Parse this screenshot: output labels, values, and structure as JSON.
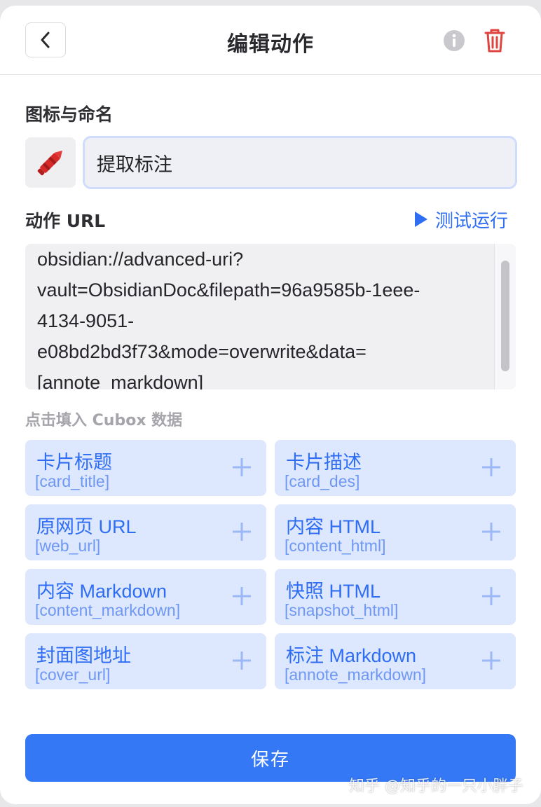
{
  "header": {
    "title": "编辑动作"
  },
  "icon_section": {
    "label": "图标与命名",
    "emoji": "🖍️",
    "name_value": "提取标注"
  },
  "url_section": {
    "label": "动作 URL",
    "test_run": "测试运行",
    "lines": [
      "obsidian://advanced-uri?",
      "vault=ObsidianDoc&filepath=96a9585b-1eee-",
      "4134-9051-",
      "e08bd2bd3f73&mode=overwrite&data=",
      "[annote_markdown]"
    ]
  },
  "hint": "点击填入 Cubox 数据",
  "cells": [
    {
      "title": "卡片标题",
      "code": "[card_title]"
    },
    {
      "title": "卡片描述",
      "code": "[card_des]"
    },
    {
      "title": "原网页 URL",
      "code": "[web_url]"
    },
    {
      "title": "内容 HTML",
      "code": "[content_html]"
    },
    {
      "title": "内容 Markdown",
      "code": "[content_markdown]"
    },
    {
      "title": "快照 HTML",
      "code": "[snapshot_html]"
    },
    {
      "title": "封面图地址",
      "code": "[cover_url]"
    },
    {
      "title": "标注 Markdown",
      "code": "[annote_markdown]"
    }
  ],
  "save_label": "保存",
  "watermark": "知乎 @知乎的一只小胖子",
  "colors": {
    "accent": "#3478f6",
    "danger": "#e0443e",
    "chip_bg": "#dde7fd"
  }
}
